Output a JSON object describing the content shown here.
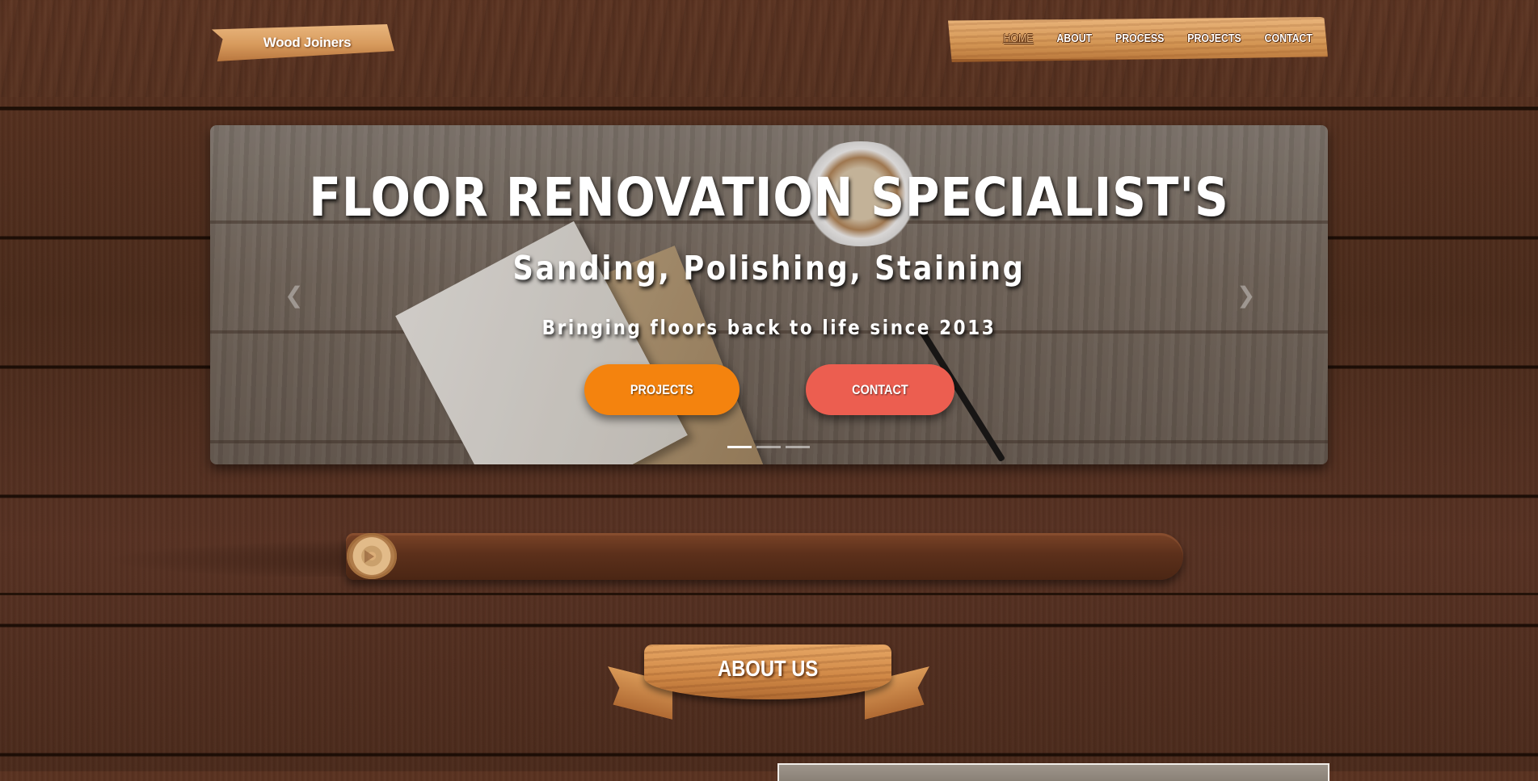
{
  "brand": {
    "name": "Wood Joiners"
  },
  "nav": {
    "items": [
      {
        "label": "HOME",
        "active": true
      },
      {
        "label": "ABOUT",
        "active": false
      },
      {
        "label": "PROCESS",
        "active": false
      },
      {
        "label": "PROJECTS",
        "active": false
      },
      {
        "label": "CONTACT",
        "active": false
      }
    ]
  },
  "hero": {
    "title": "FLOOR RENOVATION SPECIALIST'S",
    "subtitle": "Sanding, Polishing, Staining",
    "tagline": "Bringing floors back to life since 2013",
    "buttons": {
      "projects": "PROJECTS",
      "contact": "CONTACT"
    },
    "prev_icon": "chevron-left-icon",
    "next_icon": "chevron-right-icon",
    "slides": 3,
    "active_slide": 1
  },
  "about": {
    "heading": "ABOUT US"
  },
  "colors": {
    "projects_button": "#f4830e",
    "contact_button": "#ec5e50",
    "wood_light": "#e9b67e",
    "background_wood": "#4a2a1a"
  }
}
